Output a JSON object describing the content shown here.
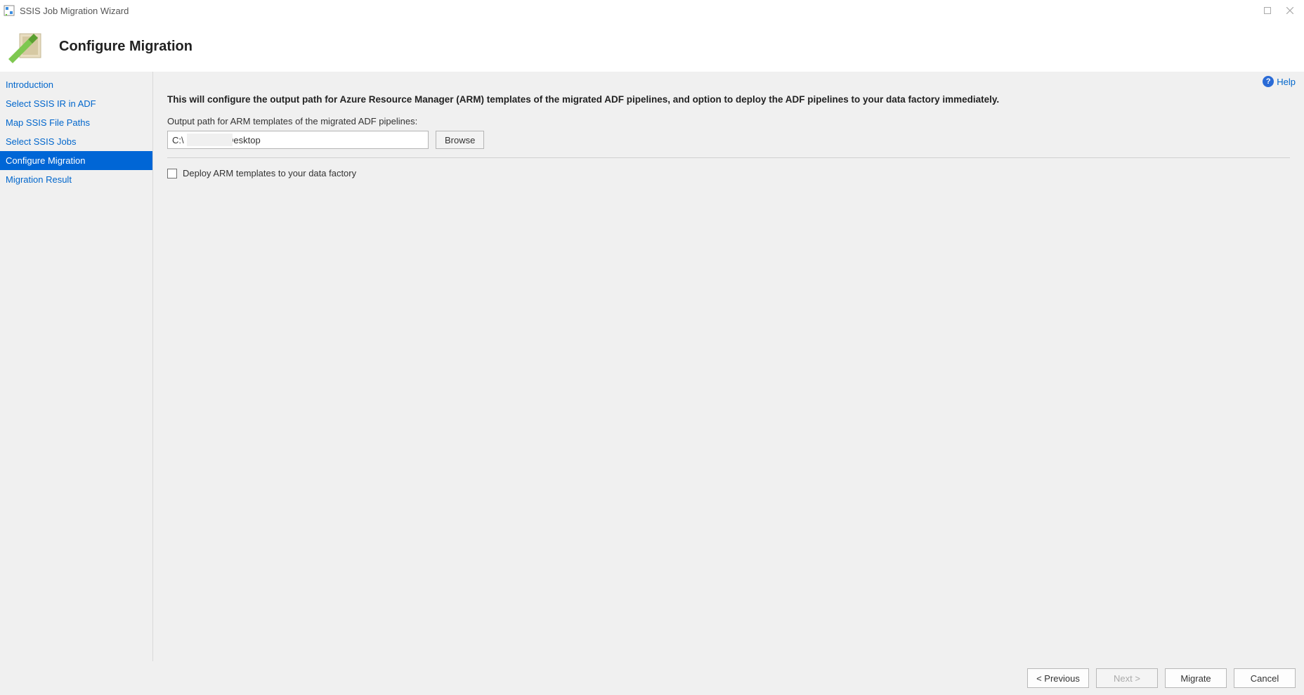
{
  "window": {
    "title": "SSIS Job Migration Wizard"
  },
  "header": {
    "title": "Configure Migration"
  },
  "sidebar": {
    "items": [
      {
        "label": "Introduction"
      },
      {
        "label": "Select SSIS IR in ADF"
      },
      {
        "label": "Map SSIS File Paths"
      },
      {
        "label": "Select SSIS Jobs"
      },
      {
        "label": "Configure Migration"
      },
      {
        "label": "Migration Result"
      }
    ],
    "active_index": 4
  },
  "content": {
    "help_label": "Help",
    "description": "This will configure the output path for Azure Resource Manager (ARM) templates of the migrated ADF pipelines, and option to deploy the ADF pipelines to your data factory immediately.",
    "output_path_label": "Output path for ARM templates of the migrated ADF pipelines:",
    "output_path_value": "C:\\                \\Desktop",
    "browse_label": "Browse",
    "deploy_checkbox_label": "Deploy ARM templates to your data factory",
    "deploy_checked": false
  },
  "footer": {
    "previous": "< Previous",
    "next": "Next >",
    "migrate": "Migrate",
    "cancel": "Cancel"
  }
}
